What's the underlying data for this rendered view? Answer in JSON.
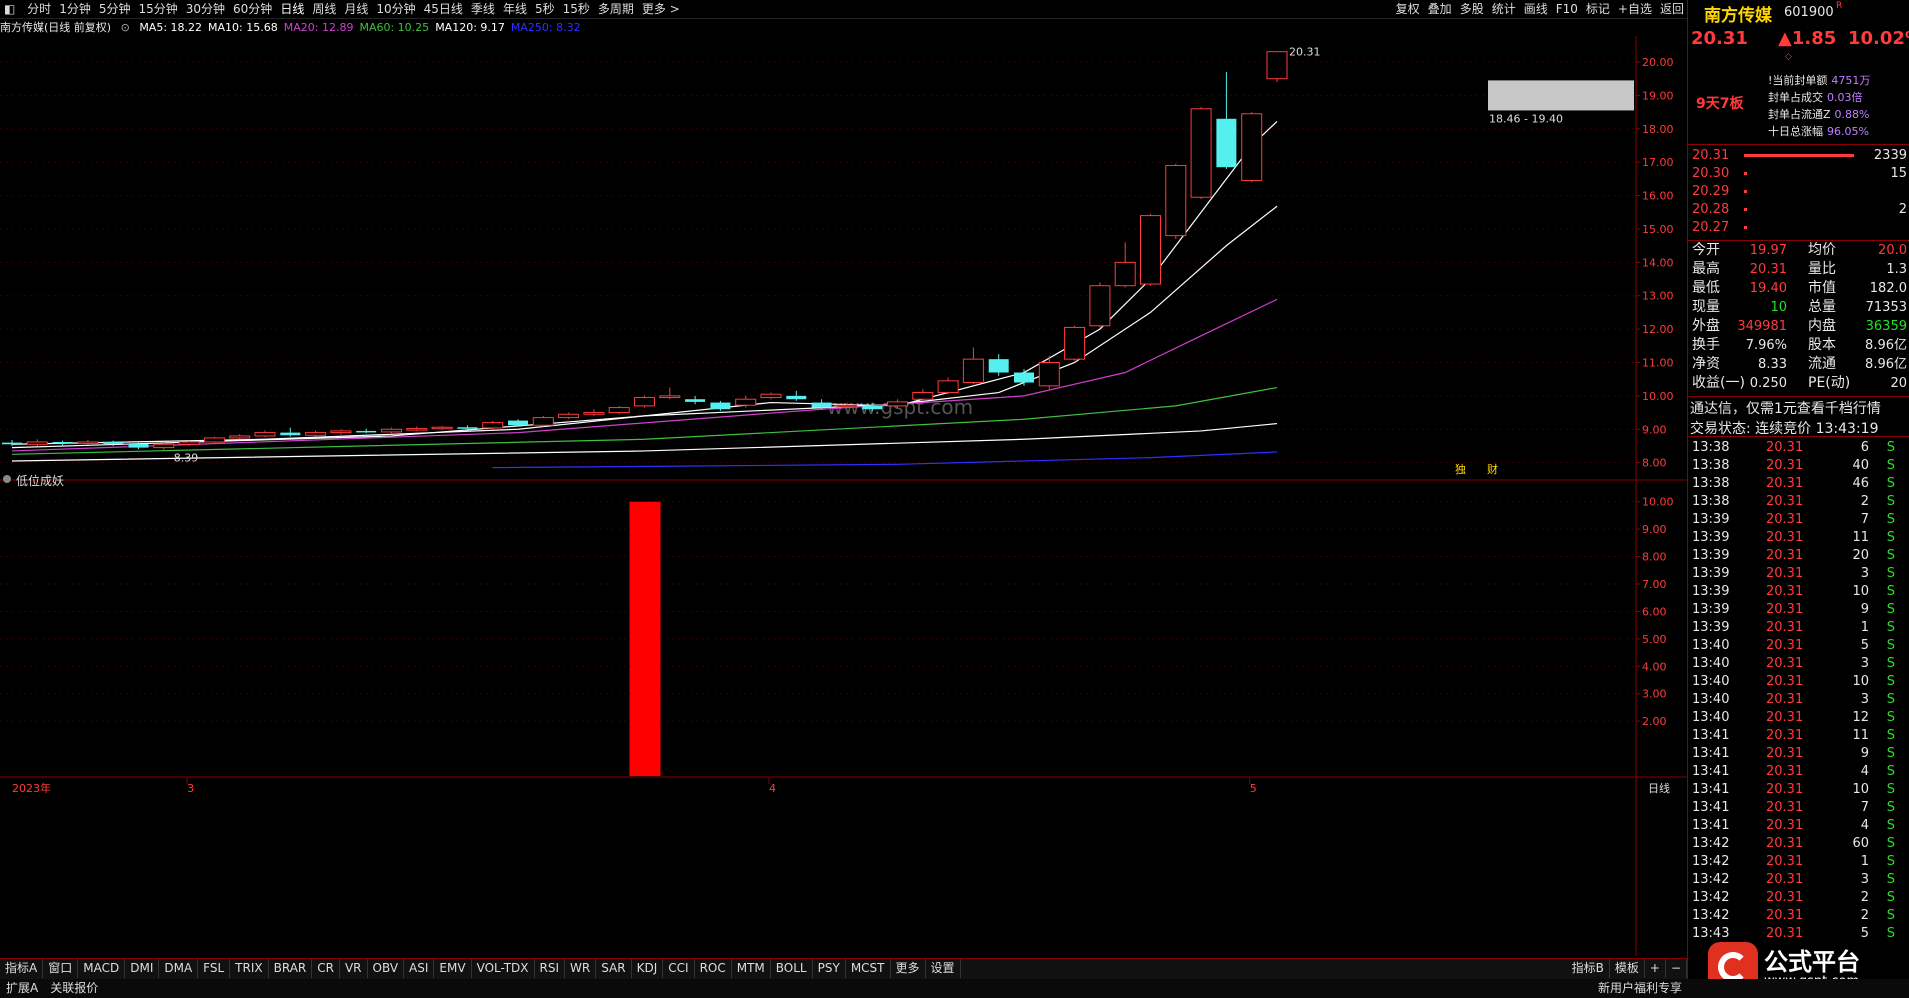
{
  "toolbar": {
    "periods": [
      "分时",
      "1分钟",
      "5分钟",
      "15分钟",
      "30分钟",
      "60分钟",
      "日线",
      "周线",
      "月线",
      "10分钟",
      "45日线",
      "季线",
      "年线",
      "5秒",
      "15秒",
      "多周期",
      "更多 >"
    ],
    "selected": "日线",
    "right_items": [
      "复权",
      "叠加",
      "多股",
      "统计",
      "画线",
      "F10",
      "标记",
      "+自选",
      "返回"
    ]
  },
  "ma_legend": {
    "title": "南方传媒(日线 前复权)",
    "items": [
      {
        "label": "MA5: 18.22",
        "color": "#ffffff"
      },
      {
        "label": "MA10: 15.68",
        "color": "#ffffff"
      },
      {
        "label": "MA20: 12.89",
        "color": "#d040d0"
      },
      {
        "label": "MA60: 10.25",
        "color": "#40c040"
      },
      {
        "label": "MA120: 9.17",
        "color": "#ffffff"
      },
      {
        "label": "MA250: 8.32",
        "color": "#3030ff"
      }
    ]
  },
  "chart_data": [
    {
      "type": "candlestick",
      "title": "南方传媒(日线 前复权)",
      "ylim": [
        7.6,
        20.6
      ],
      "y_ticks": [
        "20.00",
        "19.00",
        "18.00",
        "17.00",
        "16.00",
        "15.00",
        "14.00",
        "13.00",
        "12.00",
        "11.00",
        "10.00",
        "9.00",
        "8.00"
      ],
      "candles": [
        [
          8.6,
          8.55,
          8.68,
          8.5
        ],
        [
          8.55,
          8.62,
          8.7,
          8.5
        ],
        [
          8.62,
          8.58,
          8.66,
          8.52
        ],
        [
          8.58,
          8.62,
          8.68,
          8.54
        ],
        [
          8.62,
          8.56,
          8.66,
          8.5
        ],
        [
          8.56,
          8.45,
          8.6,
          8.4
        ],
        [
          8.45,
          8.55,
          8.6,
          8.39
        ],
        [
          8.55,
          8.62,
          8.66,
          8.5
        ],
        [
          8.62,
          8.74,
          8.78,
          8.58
        ],
        [
          8.74,
          8.8,
          8.85,
          8.7
        ],
        [
          8.8,
          8.9,
          8.96,
          8.76
        ],
        [
          8.9,
          8.82,
          9.05,
          8.78
        ],
        [
          8.82,
          8.9,
          8.96,
          8.78
        ],
        [
          8.9,
          8.95,
          9.0,
          8.84
        ],
        [
          8.95,
          8.92,
          9.02,
          8.88
        ],
        [
          8.92,
          9.0,
          9.05,
          8.88
        ],
        [
          9.0,
          9.02,
          9.08,
          8.95
        ],
        [
          9.02,
          9.06,
          9.1,
          8.98
        ],
        [
          9.06,
          9.04,
          9.12,
          9.0
        ],
        [
          9.04,
          9.2,
          9.25,
          9.0
        ],
        [
          9.26,
          9.12,
          9.3,
          9.08
        ],
        [
          9.12,
          9.35,
          9.4,
          9.08
        ],
        [
          9.35,
          9.45,
          9.5,
          9.3
        ],
        [
          9.45,
          9.5,
          9.6,
          9.4
        ],
        [
          9.5,
          9.65,
          9.7,
          9.45
        ],
        [
          9.7,
          9.95,
          10.0,
          9.65
        ],
        [
          9.95,
          10.0,
          10.25,
          9.9
        ],
        [
          9.9,
          9.82,
          10.0,
          9.75
        ],
        [
          9.8,
          9.6,
          9.85,
          9.55
        ],
        [
          9.72,
          9.9,
          10.0,
          9.65
        ],
        [
          9.95,
          10.05,
          10.1,
          9.9
        ],
        [
          10.0,
          9.9,
          10.15,
          9.85
        ],
        [
          9.8,
          9.65,
          9.9,
          9.6
        ],
        [
          9.7,
          9.72,
          9.8,
          9.66
        ],
        [
          9.7,
          9.6,
          9.8,
          9.55
        ],
        [
          9.7,
          9.82,
          9.9,
          9.65
        ],
        [
          9.9,
          10.1,
          10.2,
          9.85
        ],
        [
          10.1,
          10.45,
          10.55,
          10.05
        ],
        [
          10.4,
          11.1,
          11.45,
          10.35
        ],
        [
          11.1,
          10.7,
          11.25,
          10.6
        ],
        [
          10.7,
          10.4,
          10.8,
          10.3
        ],
        [
          10.3,
          11.0,
          11.2,
          10.2
        ],
        [
          11.1,
          12.05,
          12.1,
          11.05
        ],
        [
          12.1,
          13.3,
          13.4,
          12.05
        ],
        [
          13.3,
          14.0,
          14.6,
          13.25
        ],
        [
          13.35,
          15.4,
          15.45,
          13.3
        ],
        [
          14.8,
          16.9,
          16.95,
          14.7
        ],
        [
          15.95,
          18.6,
          18.65,
          15.9
        ],
        [
          18.3,
          16.85,
          19.7,
          16.8
        ],
        [
          16.45,
          18.45,
          18.5,
          16.4
        ],
        [
          19.5,
          20.31,
          20.31,
          19.4
        ]
      ],
      "moving_averages": [
        {
          "name": "MA5",
          "color": "#ffffff",
          "values": [
            [
              0,
              8.55
            ],
            [
              10,
              8.7
            ],
            [
              20,
              9.0
            ],
            [
              30,
              9.8
            ],
            [
              35,
              9.7
            ],
            [
              40,
              10.7
            ],
            [
              43,
              12.0
            ],
            [
              45,
              13.5
            ],
            [
              47,
              15.5
            ],
            [
              49,
              17.5
            ],
            [
              50,
              18.22
            ]
          ]
        },
        {
          "name": "MA10",
          "color": "#ffffff",
          "values": [
            [
              0,
              8.45
            ],
            [
              15,
              8.8
            ],
            [
              25,
              9.4
            ],
            [
              35,
              9.75
            ],
            [
              39,
              10.1
            ],
            [
              42,
              11.0
            ],
            [
              45,
              12.5
            ],
            [
              48,
              14.5
            ],
            [
              50,
              15.68
            ]
          ]
        },
        {
          "name": "MA20",
          "color": "#d040d0",
          "values": [
            [
              0,
              8.35
            ],
            [
              20,
              8.9
            ],
            [
              32,
              9.6
            ],
            [
              40,
              10.0
            ],
            [
              44,
              10.7
            ],
            [
              47,
              11.8
            ],
            [
              50,
              12.89
            ]
          ]
        },
        {
          "name": "MA60",
          "color": "#40c040",
          "values": [
            [
              0,
              8.25
            ],
            [
              25,
              8.7
            ],
            [
              40,
              9.3
            ],
            [
              46,
              9.7
            ],
            [
              50,
              10.25
            ]
          ]
        },
        {
          "name": "MA120",
          "color": "#ffffff",
          "values": [
            [
              0,
              8.05
            ],
            [
              25,
              8.35
            ],
            [
              40,
              8.7
            ],
            [
              47,
              8.95
            ],
            [
              50,
              9.17
            ]
          ]
        },
        {
          "name": "MA250",
          "color": "#3030ff",
          "values": [
            [
              19,
              7.85
            ],
            [
              35,
              7.95
            ],
            [
              45,
              8.15
            ],
            [
              50,
              8.32
            ]
          ]
        }
      ],
      "annotations": {
        "high_label": "20.31",
        "low_label": "8.39",
        "gap_label": "18.46 - 19.40",
        "gap_range": [
          18.46,
          19.4
        ],
        "badges": [
          "独",
          "财"
        ]
      }
    },
    {
      "type": "bar",
      "title": "低位成妖",
      "ylim": [
        0,
        10.5
      ],
      "y_ticks": [
        "10.00",
        "9.00",
        "8.00",
        "7.00",
        "6.00",
        "5.00",
        "4.00",
        "3.00",
        "2.00"
      ],
      "bars": [
        {
          "index": 25,
          "value": 10.0,
          "color": "#ff0000"
        }
      ]
    }
  ],
  "x_axis": {
    "labels": [
      {
        "text": "2023年",
        "index": 0
      },
      {
        "text": "3",
        "index": 7
      },
      {
        "text": "4",
        "index": 30
      },
      {
        "text": "5",
        "index": 49
      }
    ],
    "period_label": "日线"
  },
  "watermark": "www.gspt.com",
  "right_panel": {
    "stock_name": "南方传媒",
    "stock_code": "601900",
    "r_mark": "R",
    "price": "20.31",
    "change": "▲1.85",
    "change_pct": "10.02%",
    "limit_tag": "9天7板",
    "seal_info": [
      {
        "label": "!当前封单额",
        "value": "4751万"
      },
      {
        "label": "封单占成交",
        "value": "0.03倍"
      },
      {
        "label": "封单占流通Z",
        "value": "0.88%"
      },
      {
        "label": "十日总涨幅",
        "value": "96.05%"
      }
    ],
    "order_book": [
      {
        "price": "20.31",
        "vol": "2339"
      },
      {
        "price": "20.30",
        "vol": "15"
      },
      {
        "price": "20.29",
        "vol": ""
      },
      {
        "price": "20.28",
        "vol": "2"
      },
      {
        "price": "20.27",
        "vol": ""
      }
    ],
    "stats": [
      {
        "l1": "今开",
        "v1": "19.97",
        "l2": "均价",
        "v2": "20.0"
      },
      {
        "l1": "最高",
        "v1": "20.31",
        "l2": "量比",
        "v2": "1.3"
      },
      {
        "l1": "最低",
        "v1": "19.40",
        "l2": "市值",
        "v2": "182.0"
      },
      {
        "l1": "现量",
        "v1": "10",
        "l2": "总量",
        "v2": "71353"
      },
      {
        "l1": "外盘",
        "v1": "349981",
        "l2": "内盘",
        "v2": "36359"
      },
      {
        "l1": "换手",
        "v1": "7.96%",
        "l2": "股本",
        "v2": "8.96亿"
      },
      {
        "l1": "净资",
        "v1": "8.33",
        "l2": "流通",
        "v2": "8.96亿"
      },
      {
        "l1": "收益(一)",
        "v1": "0.250",
        "l2": "PE(动)",
        "v2": "20"
      }
    ],
    "promo": "通达信，仅需1元查看千档行情",
    "trade_status": "交易状态: 连续竞价 13:43:19",
    "ticks": [
      {
        "t": "13:38",
        "p": "20.31",
        "v": "6",
        "s": "S"
      },
      {
        "t": "13:38",
        "p": "20.31",
        "v": "40",
        "s": "S"
      },
      {
        "t": "13:38",
        "p": "20.31",
        "v": "46",
        "s": "S"
      },
      {
        "t": "13:38",
        "p": "20.31",
        "v": "2",
        "s": "S"
      },
      {
        "t": "13:39",
        "p": "20.31",
        "v": "7",
        "s": "S"
      },
      {
        "t": "13:39",
        "p": "20.31",
        "v": "11",
        "s": "S"
      },
      {
        "t": "13:39",
        "p": "20.31",
        "v": "20",
        "s": "S"
      },
      {
        "t": "13:39",
        "p": "20.31",
        "v": "3",
        "s": "S"
      },
      {
        "t": "13:39",
        "p": "20.31",
        "v": "10",
        "s": "S"
      },
      {
        "t": "13:39",
        "p": "20.31",
        "v": "9",
        "s": "S"
      },
      {
        "t": "13:39",
        "p": "20.31",
        "v": "1",
        "s": "S"
      },
      {
        "t": "13:40",
        "p": "20.31",
        "v": "5",
        "s": "S"
      },
      {
        "t": "13:40",
        "p": "20.31",
        "v": "3",
        "s": "S"
      },
      {
        "t": "13:40",
        "p": "20.31",
        "v": "10",
        "s": "S"
      },
      {
        "t": "13:40",
        "p": "20.31",
        "v": "3",
        "s": "S"
      },
      {
        "t": "13:40",
        "p": "20.31",
        "v": "12",
        "s": "S"
      },
      {
        "t": "13:41",
        "p": "20.31",
        "v": "11",
        "s": "S"
      },
      {
        "t": "13:41",
        "p": "20.31",
        "v": "9",
        "s": "S"
      },
      {
        "t": "13:41",
        "p": "20.31",
        "v": "4",
        "s": "S"
      },
      {
        "t": "13:41",
        "p": "20.31",
        "v": "10",
        "s": "S"
      },
      {
        "t": "13:41",
        "p": "20.31",
        "v": "7",
        "s": "S"
      },
      {
        "t": "13:41",
        "p": "20.31",
        "v": "4",
        "s": "S"
      },
      {
        "t": "13:42",
        "p": "20.31",
        "v": "60",
        "s": "S"
      },
      {
        "t": "13:42",
        "p": "20.31",
        "v": "1",
        "s": "S"
      },
      {
        "t": "13:42",
        "p": "20.31",
        "v": "3",
        "s": "S"
      },
      {
        "t": "13:42",
        "p": "20.31",
        "v": "2",
        "s": "S"
      },
      {
        "t": "13:42",
        "p": "20.31",
        "v": "2",
        "s": "S"
      },
      {
        "t": "13:43",
        "p": "20.31",
        "v": "5",
        "s": "S"
      }
    ],
    "logo_text": "公式平台",
    "logo_url": "www.gspt.com"
  },
  "bottom_tabs": [
    "指标A",
    "窗口",
    "MACD",
    "DMI",
    "DMA",
    "FSL",
    "TRIX",
    "BRAR",
    "CR",
    "VR",
    "OBV",
    "ASI",
    "EMV",
    "VOL-TDX",
    "RSI",
    "WR",
    "SAR",
    "KDJ",
    "CCI",
    "ROC",
    "MTM",
    "BOLL",
    "PSY",
    "MCST",
    "更多",
    "设置"
  ],
  "bottom_right_tabs": [
    "指标B",
    "模板",
    "+",
    "−"
  ],
  "status_bar": {
    "left": [
      "扩展A",
      "关联报价"
    ],
    "right": "新用户福利专享"
  }
}
